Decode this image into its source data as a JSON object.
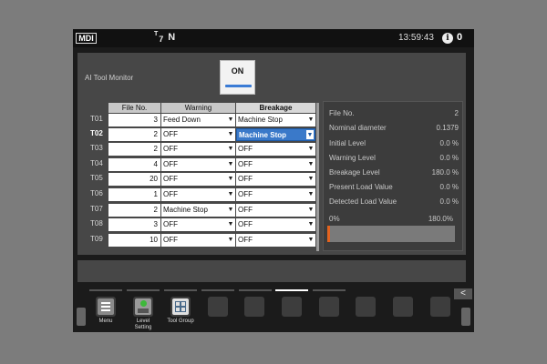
{
  "status_bar": {
    "mode": "MDI",
    "tool_sup": "T",
    "tool_sub": "7",
    "axis": "N",
    "clock": "13:59:43",
    "info_icon": "i",
    "alarm_count": "0"
  },
  "panel": {
    "title": "AI Tool Monitor",
    "toggle_label": "ON",
    "toggle_state": "on"
  },
  "table": {
    "headers": {
      "file": "File No.",
      "warning": "Warning",
      "breakage": "Breakage"
    },
    "rows": [
      {
        "tool": "T01",
        "file": "3",
        "warning": "Feed Down",
        "breakage": "Machine Stop"
      },
      {
        "tool": "T02",
        "file": "2",
        "warning": "OFF",
        "breakage": "Machine Stop"
      },
      {
        "tool": "T03",
        "file": "2",
        "warning": "OFF",
        "breakage": "OFF"
      },
      {
        "tool": "T04",
        "file": "4",
        "warning": "OFF",
        "breakage": "OFF"
      },
      {
        "tool": "T05",
        "file": "20",
        "warning": "OFF",
        "breakage": "OFF"
      },
      {
        "tool": "T06",
        "file": "1",
        "warning": "OFF",
        "breakage": "OFF"
      },
      {
        "tool": "T07",
        "file": "2",
        "warning": "Machine Stop",
        "breakage": "OFF"
      },
      {
        "tool": "T08",
        "file": "3",
        "warning": "OFF",
        "breakage": "OFF"
      },
      {
        "tool": "T09",
        "file": "10",
        "warning": "OFF",
        "breakage": "OFF"
      }
    ],
    "selected_row": "T02"
  },
  "info": {
    "file_no_label": "File No.",
    "file_no_value": "2",
    "nominal_label": "Nominal diameter",
    "nominal_value": "0.1379",
    "initial_label": "Initial Level",
    "initial_value": "0.0 %",
    "warning_label": "Warning Level",
    "warning_value": "0.0 %",
    "breakage_label": "Breakage Level",
    "breakage_value": "180.0 %",
    "present_label": "Present Load Value",
    "present_value": "0.0 %",
    "detected_label": "Detected Load Value",
    "detected_value": "0.0 %",
    "bar_min": "0%",
    "bar_max": "180.0%",
    "bar_level": 0
  },
  "softkeys": {
    "menu": "Menu",
    "level_setting_1": "Level",
    "level_setting_2": "Setting",
    "tool_group": "Tool Group",
    "back": "<"
  },
  "colors": {
    "accent": "#3a79c9",
    "load_fill": "#e3631f",
    "level_dot": "#3db83a"
  }
}
